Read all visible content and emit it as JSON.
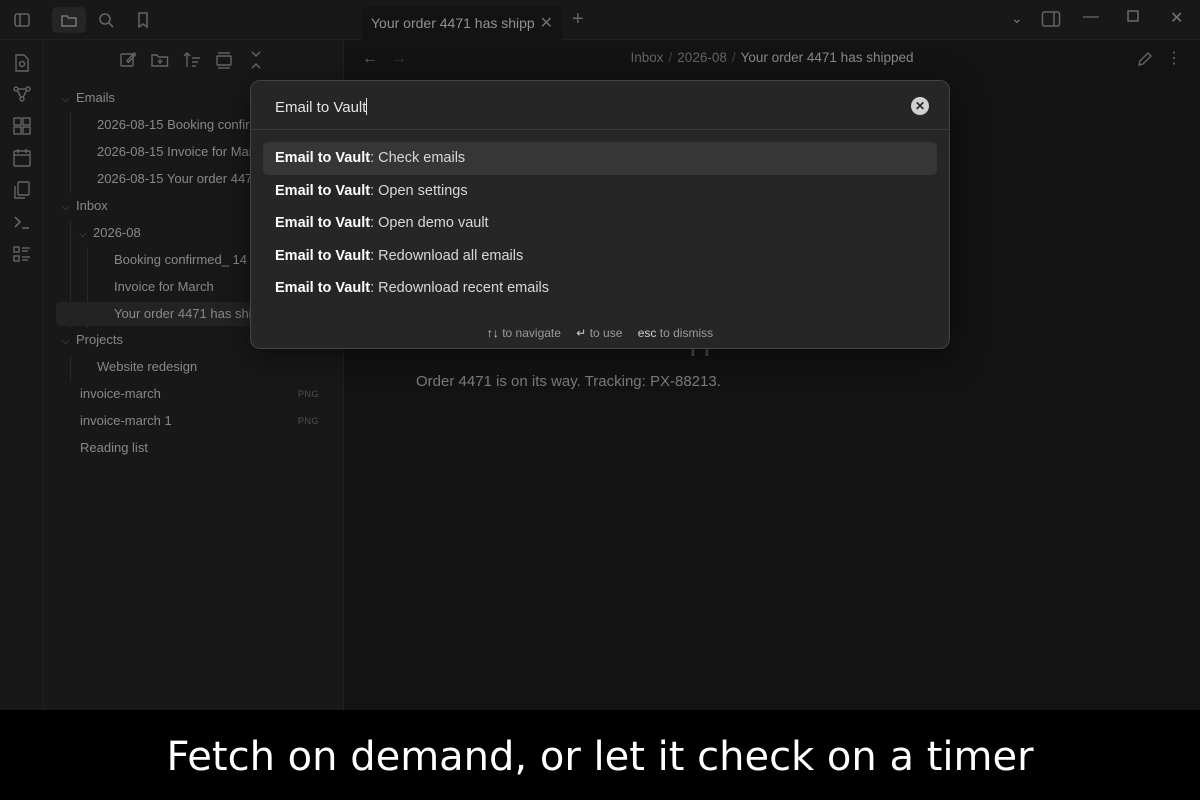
{
  "tab": {
    "title": "Your order 4471 has shipped",
    "title_display": "Your order 4471 has shipp..."
  },
  "sidebar": {
    "items": [
      {
        "label": "Emails",
        "type": "folder"
      },
      {
        "label": "2026-08-15 Booking confirmed_ 14",
        "type": "file"
      },
      {
        "label": "2026-08-15 Invoice for March",
        "type": "file"
      },
      {
        "label": "2026-08-15 Your order 4471 has shipped",
        "type": "file"
      },
      {
        "label": "Inbox",
        "type": "folder"
      },
      {
        "label": "2026-08",
        "type": "folder"
      },
      {
        "label": "Booking confirmed_ 14",
        "type": "file"
      },
      {
        "label": "Invoice for March",
        "type": "file"
      },
      {
        "label": "Your order 4471 has shipped",
        "type": "file",
        "active": true
      },
      {
        "label": "Projects",
        "type": "folder"
      },
      {
        "label": "Website redesign",
        "type": "file"
      },
      {
        "label": "invoice-march",
        "type": "file",
        "badge": "PNG"
      },
      {
        "label": "invoice-march 1",
        "type": "file",
        "badge": "PNG"
      },
      {
        "label": "Reading list",
        "type": "file"
      }
    ]
  },
  "breadcrumb": {
    "part1": "Inbox",
    "part2": "2026-08",
    "current": "Your order 4471 has shipped"
  },
  "note": {
    "body": "Order 4471 is on its way. Tracking: PX-88213."
  },
  "palette": {
    "query": "Email to Vault",
    "items": [
      {
        "prefix": "Email to Vault",
        "rest": ": Check emails"
      },
      {
        "prefix": "Email to Vault",
        "rest": ": Open settings"
      },
      {
        "prefix": "Email to Vault",
        "rest": ": Open demo vault"
      },
      {
        "prefix": "Email to Vault",
        "rest": ": Redownload all emails"
      },
      {
        "prefix": "Email to Vault",
        "rest": ": Redownload recent emails"
      }
    ],
    "footer": {
      "nav_key": "↑↓",
      "nav_label": "to navigate",
      "use_key": "↵",
      "use_label": "to use",
      "esc_key": "esc",
      "esc_label": "to dismiss"
    }
  },
  "caption": {
    "text": "Fetch on demand, or let it check on a timer"
  },
  "accent": "#363636"
}
